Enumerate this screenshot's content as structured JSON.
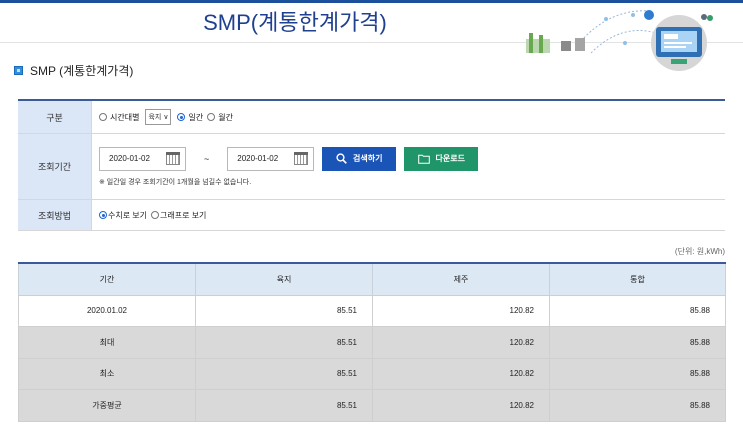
{
  "banner": {
    "title": "SMP(계통한계가격)"
  },
  "section_title": "SMP (계통한계가격)",
  "form": {
    "row_category": {
      "label": "구분",
      "option_hourly": "시간대별",
      "region_select": "육지",
      "option_daily": "일간",
      "option_monthly": "월간",
      "selected": "일간"
    },
    "row_period": {
      "label": "조회기간",
      "start_date": "2020-01-02",
      "tilde": "~",
      "end_date": "2020-01-02",
      "search_label": "검색하기",
      "download_label": "다운로드",
      "note": "※ 일간일 경우 조회기간이 1개월을 넘길수 없습니다."
    },
    "row_method": {
      "label": "조회방법",
      "option_numeric": "수치로 보기",
      "option_graph": "그래프로 보기",
      "selected": "수치로 보기"
    }
  },
  "unit_text": "(단위: 원,kWh)",
  "table": {
    "headers": [
      "기간",
      "육지",
      "제주",
      "통합"
    ],
    "rows": [
      [
        "2020.01.02",
        "85.51",
        "120.82",
        "85.88"
      ],
      [
        "최대",
        "85.51",
        "120.82",
        "85.88"
      ],
      [
        "최소",
        "85.51",
        "120.82",
        "85.88"
      ],
      [
        "가중평균",
        "85.51",
        "120.82",
        "85.88"
      ]
    ]
  },
  "colors": {
    "header_navy": "#1c4f9c",
    "label_bg": "#dbe7f6",
    "search_button": "#1a54b6",
    "download_button": "#1f9569",
    "summary_row_bg": "#d9d9d9"
  }
}
